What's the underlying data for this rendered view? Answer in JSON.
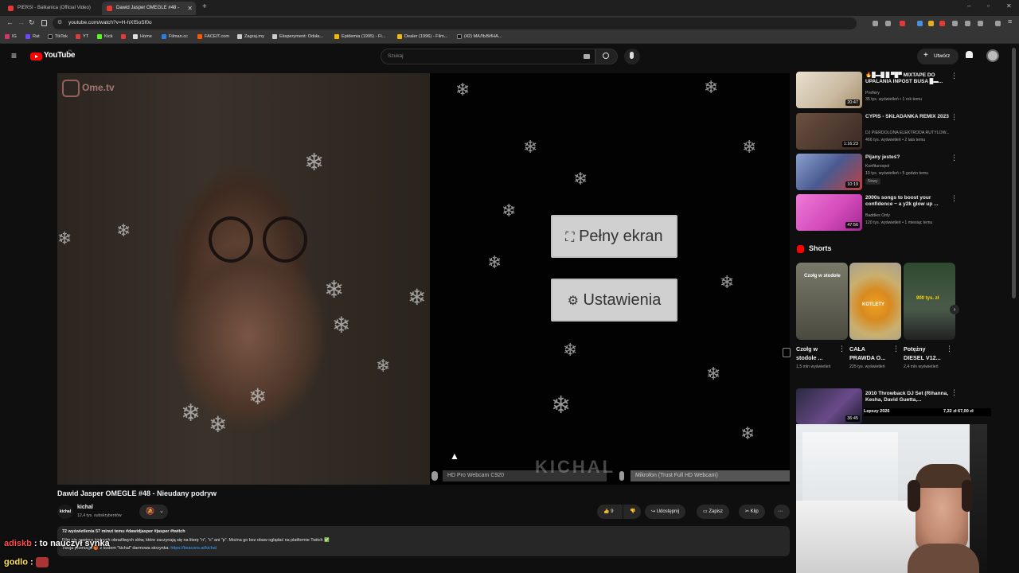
{
  "browser": {
    "tabs": [
      {
        "title": "PIERSI - Balkanica (Official Video)"
      },
      {
        "title": "Dawid Jasper OMEGLE #48 -",
        "active": true
      }
    ],
    "url": "youtube.com/watch?v=H-hXfSoSf0o",
    "bookmarks": [
      "IG",
      "Rat",
      "TikTok",
      "YT",
      "Kick",
      "Home",
      "Filman.cc",
      "FACEIT.com",
      "Zagraj.my",
      "Eksperyment: Odsła...",
      "Epidemia (1995) - Fi...",
      "Dealer (1996) - Film...",
      "(42) МАЛЬВИНА..."
    ]
  },
  "youtube": {
    "logo": "YouTube",
    "country": "PL",
    "search_placeholder": "Szukaj",
    "create_label": "Utwórz"
  },
  "player": {
    "omegle_logo": "Ome.tv",
    "fullscreen_label": "Pełny ekran",
    "settings_label": "Ustawienia",
    "webcam_label": "HD Pro Webcam C920",
    "mic_label": "Mikrofon (Trust Full HD Webcam)",
    "watermark": "KICHAL"
  },
  "video": {
    "title": "Dawid Jasper OMEGLE #48 - Nieudany podryw",
    "channel": "kichal",
    "subscribers": "12,4 tys. subskrybentów",
    "likes": "9",
    "share_label": "Udostępnij",
    "save_label": "Zapisz",
    "clip_label": "Klip",
    "desc_line1": "72 wyświetlenia  57 minut temu  #dawidjasper #jasper #twitch",
    "desc_line2": "Film nie zawiera żadnych obraźliwych słów, które zaczynają się na literę \"n\", \"c\" ani \"p\". Można go bez obaw oglądać na platformie Twitch ✅",
    "desc_line3_prefix": "Twoja promocja 🎁 z kodem \"kichal\" darmowa skrzynka:",
    "desc_link": "https://beacons.ai/kichal"
  },
  "chat": [
    {
      "user": "adiskb",
      "text": "to nauczył synka"
    },
    {
      "user": "godlo",
      "text": ""
    }
  ],
  "recommendations": [
    {
      "title": "🔥█▬█ █ ▀█▀ MIXTAPE DO UPALANIA INPOST BUSA █▬...",
      "channel": "Prefiery",
      "meta": "35 tys. wyświetleń • 1 rok temu",
      "duration": "20:47",
      "color": "#c9b9a0"
    },
    {
      "title": "CYPIS - SKŁADANKA REMIX 2023",
      "channel": "DJ PIERDOLONA ELEKTRODA RUTYLOW...",
      "meta": "466 tys. wyświetleń • 2 lata temu",
      "duration": "1:16:23",
      "color": "#4a3a32"
    },
    {
      "title": "Pijany jesteś?",
      "channel": "Konfiturespol",
      "meta": "10 tys. wyświetleń • 5 godzin temu",
      "badge": "Nowy",
      "duration": "10:19",
      "color": "#5a6aa0"
    },
    {
      "title": "2000s songs to boost your confidence ~ a y2k glow up ...",
      "channel": "Baddies Only",
      "meta": "120 tys. wyświetleń • 1 miesiąc temu",
      "duration": "47:56",
      "color": "#e060c0"
    }
  ],
  "shorts": {
    "heading": "Shorts",
    "items": [
      {
        "title": "Czołg w stodole ...",
        "views": "1,5 mln wyświetleń",
        "overlay": "Czołg w stodole",
        "color": "#5a5a52"
      },
      {
        "title": "CAŁA PRAWDA O...",
        "views": "225 tys. wyświetleń",
        "overlay": "KOTLETY",
        "color": "#d88a20"
      },
      {
        "title": "Potężny DIESEL V12...",
        "views": "2,4 mln wyświetleń",
        "overlay": "900 tys. zł",
        "color": "#3a4a3a"
      }
    ]
  },
  "bottom_rec": {
    "title": "2010 Throwback DJ Set (Rihanna, Kesha, David Guetta,...",
    "duration": "36:45",
    "tag": "Lepszy 2026",
    "price": "7,22 zł  67,00 zł"
  }
}
